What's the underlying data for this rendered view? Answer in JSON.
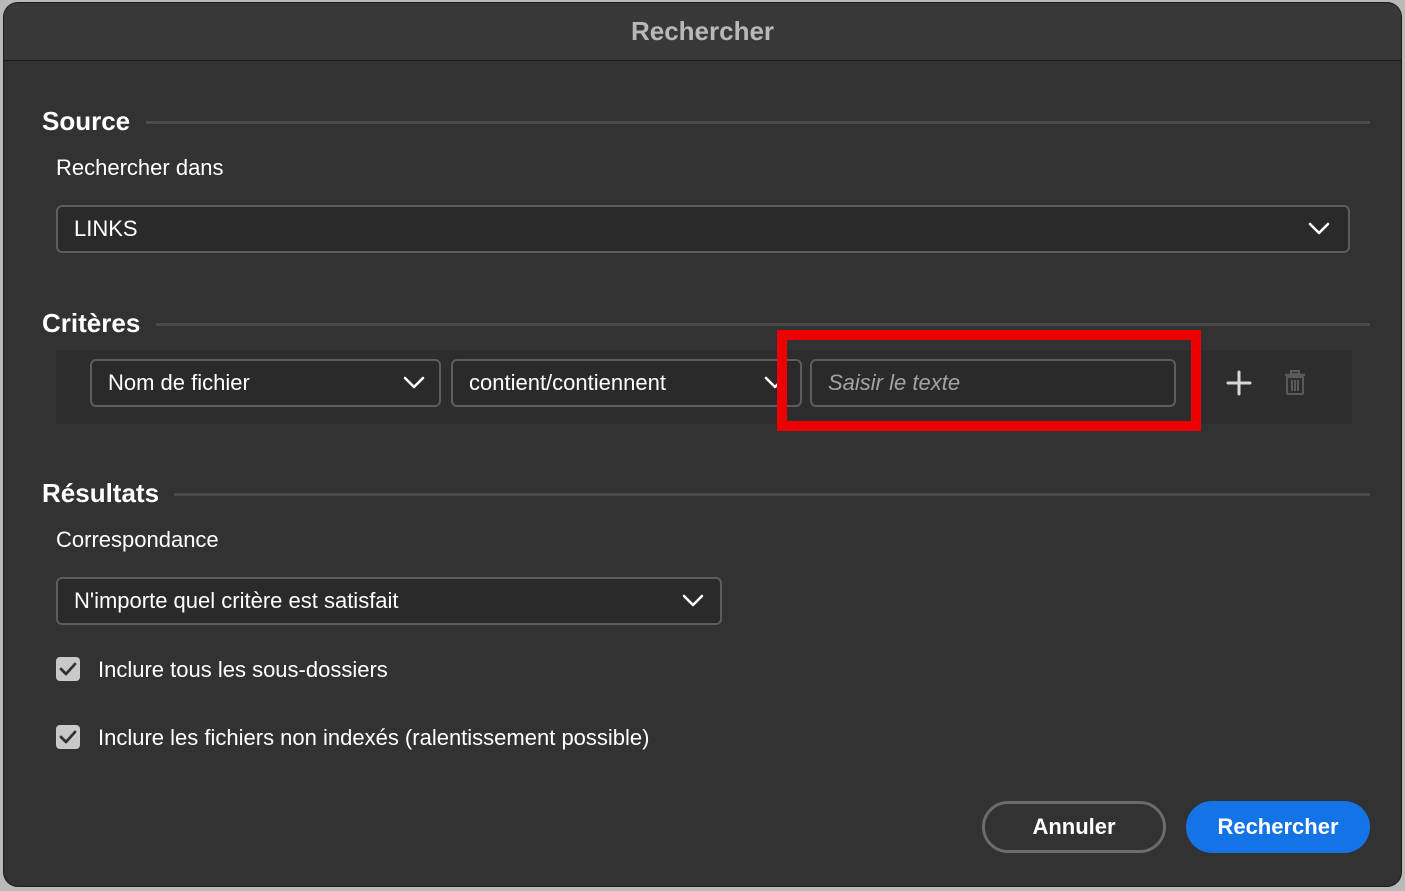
{
  "window": {
    "title": "Rechercher"
  },
  "source": {
    "section_title": "Source",
    "search_in_label": "Rechercher dans",
    "search_in_value": "LINKS"
  },
  "criteria": {
    "section_title": "Critères",
    "field_value": "Nom de fichier",
    "operator_value": "contient/contiennent",
    "text_placeholder": "Saisir le texte",
    "text_value": "",
    "add_icon": "plus-icon",
    "delete_icon": "trash-icon"
  },
  "results": {
    "section_title": "Résultats",
    "match_label": "Correspondance",
    "match_value": "N'importe quel critère est satisfait",
    "include_subfolders_label": "Inclure tous les sous-dossiers",
    "include_subfolders_checked": true,
    "include_unindexed_label": "Inclure les fichiers non indexés (ralentissement possible)",
    "include_unindexed_checked": true
  },
  "footer": {
    "cancel_label": "Annuler",
    "search_label": "Rechercher"
  },
  "colors": {
    "accent": "#1473e6",
    "highlight": "#ee0000",
    "background": "#323232"
  }
}
